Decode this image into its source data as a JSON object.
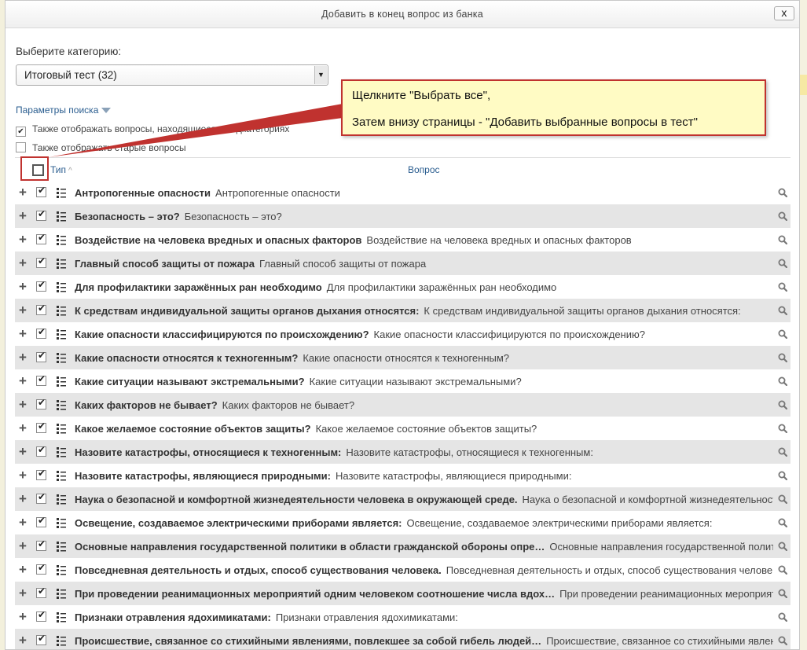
{
  "dialog": {
    "title": "Добавить в конец вопрос из банка",
    "close_label": "x"
  },
  "category": {
    "label": "Выберите категорию:",
    "selected": "Итоговый тест (32)"
  },
  "search": {
    "params_label": "Параметры поиска",
    "option_subcategories": "Также отображать вопросы, находящиеся в подкатегориях",
    "option_subcategories_checked": true,
    "option_old": "Также отображать старые вопросы",
    "option_old_checked": false
  },
  "table": {
    "col_type": "Тип",
    "col_type_sort": "^",
    "col_question": "Вопрос",
    "rows": [
      {
        "name": "Антропогенные опасности",
        "text": "Антропогенные опасности"
      },
      {
        "name": "Безопасность – это?",
        "text": "Безопасность – это?"
      },
      {
        "name": "Воздействие на человека вредных и опасных факторов",
        "text": "Воздействие на человека вредных и опасных факторов"
      },
      {
        "name": "Главный способ защиты от пожара",
        "text": "Главный способ защиты от пожара"
      },
      {
        "name": "Для профилактики заражённых ран необходимо",
        "text": "Для профилактики заражённых ран необходимо"
      },
      {
        "name": "К средствам индивидуальной защиты органов дыхания относятся:",
        "text": "К средствам индивидуальной защиты органов дыхания относятся:"
      },
      {
        "name": "Какие опасности классифицируются по происхождению?",
        "text": "Какие опасности классифицируются по происхождению?"
      },
      {
        "name": "Какие опасности относятся к техногенным?",
        "text": "Какие опасности относятся к техногенным?"
      },
      {
        "name": "Какие ситуации называют экстремальными?",
        "text": "Какие ситуации называют экстремальными?"
      },
      {
        "name": "Каких факторов не бывает?",
        "text": "Каких факторов не бывает?"
      },
      {
        "name": "Какое желаемое состояние объектов защиты?",
        "text": "Какое желаемое состояние объектов защиты?"
      },
      {
        "name": "Назовите катастрофы, относящиеся к техногенным:",
        "text": "Назовите катастрофы, относящиеся к техногенным:"
      },
      {
        "name": "Назовите катастрофы, являющиеся природными:",
        "text": "Назовите катастрофы, являющиеся природными:"
      },
      {
        "name": "Наука о безопасной и комфортной жизнедеятельности человека в окружающей среде.",
        "text": "Наука о безопасной и комфортной жизнедеятельности человека в окружающей среде."
      },
      {
        "name": "Освещение, создаваемое электрическими приборами является:",
        "text": "Освещение, создаваемое электрическими приборами является:"
      },
      {
        "name": "Основные направления государственной политики в области гражданской обороны опре…",
        "text": "Основные направления государственной политики в области гражданской обороны"
      },
      {
        "name": "Повседневная деятельность и отдых, способ существования человека.",
        "text": "Повседневная деятельность и отдых, способ существования человека."
      },
      {
        "name": "При проведении реанимационных мероприятий одним человеком соотношение числа вдох…",
        "text": "При проведении реанимационных мероприятий одним человеком соотношение числа вдохов"
      },
      {
        "name": "Признаки отравления ядохимикатами:",
        "text": "Признаки отравления ядохимикатами:"
      },
      {
        "name": "Происшествие, связанное со стихийными явлениями, повлекшее за собой гибель людей…",
        "text": "Происшествие, связанное со стихийными явлениями, повлекшее за собой гибель людей"
      }
    ]
  },
  "callout": {
    "line1": "Щелкните \"Выбрать все\",",
    "line2": "Затем внизу страницы - \"Добавить выбранные вопросы в тест\""
  },
  "colors": {
    "callout_border": "#c0322f",
    "callout_bg": "#fffbc4",
    "link": "#2a5d8f",
    "row_alt": "#e5e5e5"
  }
}
